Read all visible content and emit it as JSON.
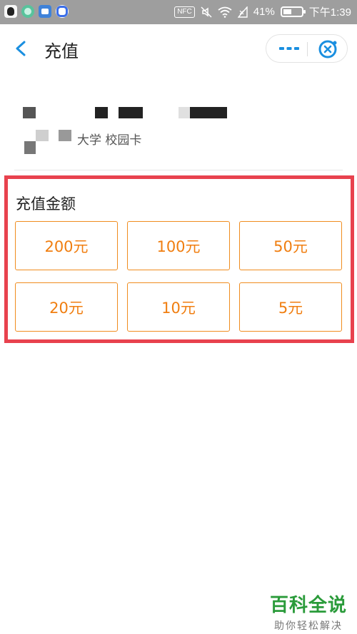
{
  "status_bar": {
    "nfc": "NFC",
    "battery": "41%",
    "time": "下午1:39",
    "apps": [
      "qq-icon",
      "chat-bubble-icon",
      "mail-icon",
      "browser-q-icon"
    ]
  },
  "nav": {
    "title": "充值",
    "accent": "#1a8fe0"
  },
  "card": {
    "name_suffix": "大学 校园卡"
  },
  "amount": {
    "title": "充值金额",
    "options": [
      "200元",
      "100元",
      "50元",
      "20元",
      "10元",
      "5元"
    ],
    "accent": "#f07e10",
    "highlight_color": "#e8424e"
  },
  "watermark": {
    "main": "百科全说",
    "sub": "助你轻松解决"
  }
}
